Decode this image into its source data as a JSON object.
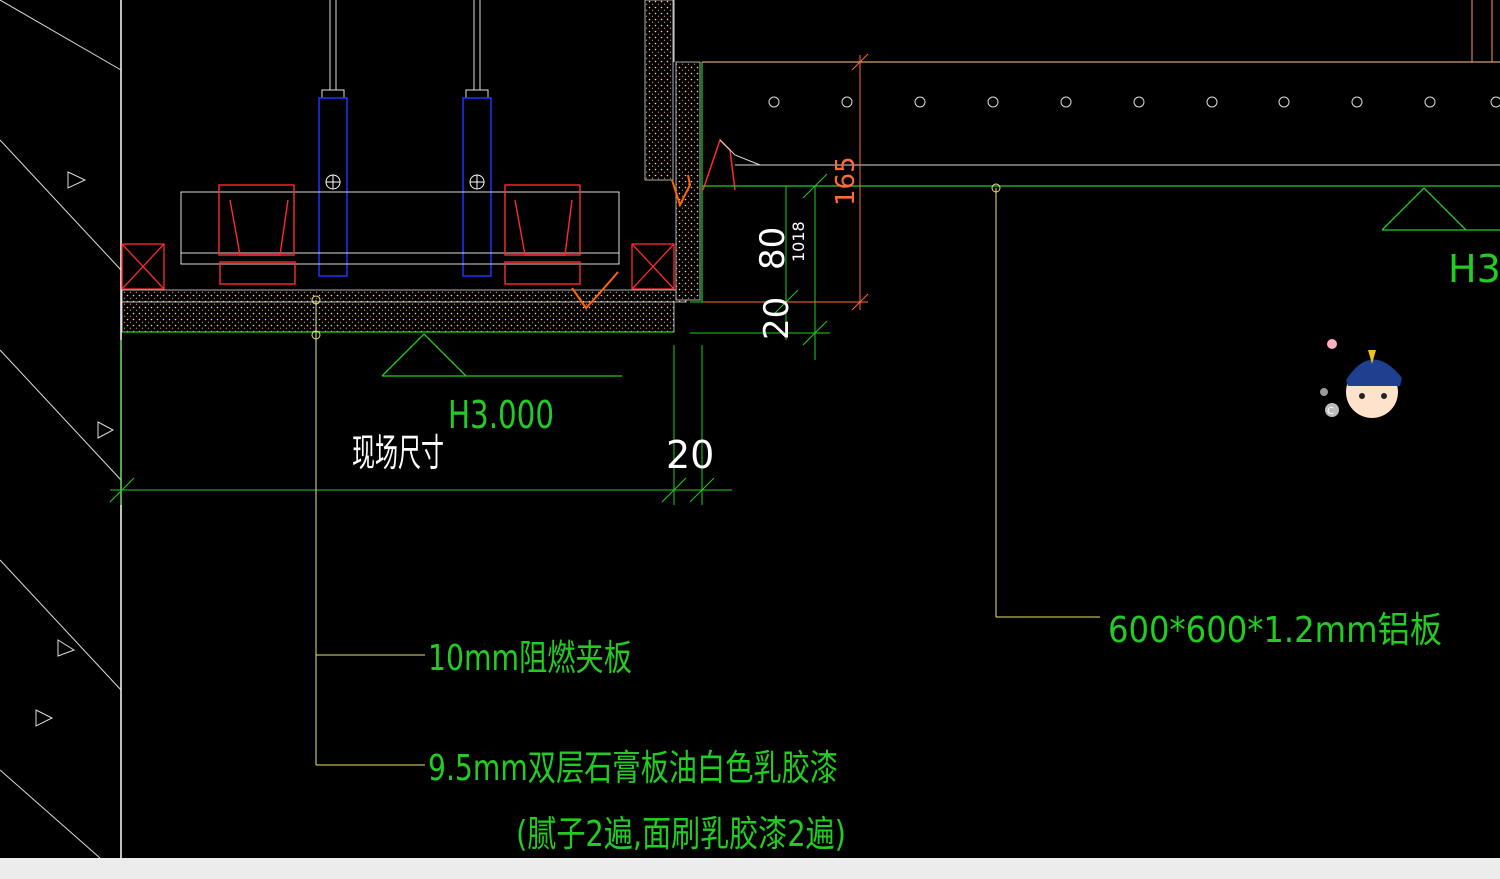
{
  "drawing": {
    "level_left": "H3.000",
    "level_right": "H3.",
    "field_dimension": "现场尺寸",
    "dims": {
      "d20_bottom": "20",
      "d80": "80",
      "d1018": "1018",
      "d20_side": "20",
      "d165": "165"
    },
    "callouts": {
      "c1": "10mm阻燃夹板",
      "c2": "9.5mm双层石膏板油白色乳胶漆",
      "c3": "(腻子2遍,面刷乳胶漆2遍)",
      "c4": "600*600*1.2mm铝板"
    },
    "colors": {
      "background": "#000000",
      "green": "#22cc22",
      "yellow": "#e8e870",
      "red": "#ff2a2a",
      "blue": "#2233ff",
      "white": "#ffffff",
      "orange": "#ff6600"
    }
  }
}
